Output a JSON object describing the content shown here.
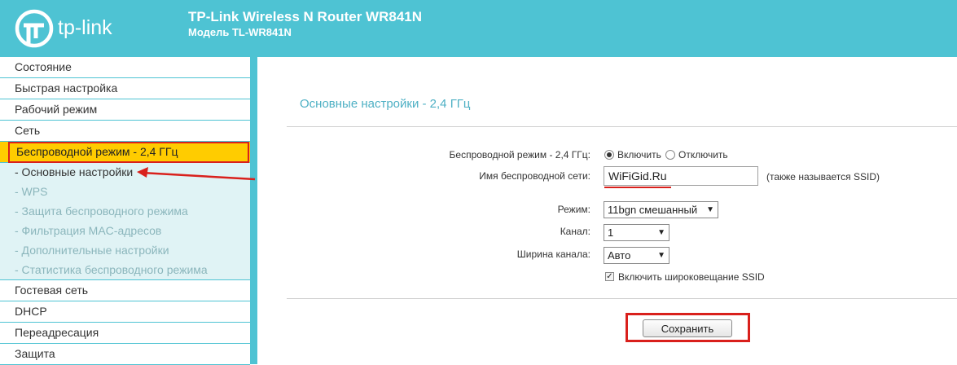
{
  "header": {
    "logo_text": "tp-link",
    "title": "TP-Link Wireless N Router WR841N",
    "model": "Модель TL-WR841N"
  },
  "sidebar": {
    "items_top": [
      {
        "label": "Состояние"
      },
      {
        "label": "Быстрая настройка"
      },
      {
        "label": "Рабочий режим"
      },
      {
        "label": "Сеть"
      }
    ],
    "active": {
      "label": "Беспроводной режим - 2,4 ГГц"
    },
    "sub_items": [
      {
        "label": "- Основные настройки"
      },
      {
        "label": "- WPS"
      },
      {
        "label": "- Защита беспроводного режима"
      },
      {
        "label": "- Фильтрация MAC-адресов"
      },
      {
        "label": "- Дополнительные настройки"
      },
      {
        "label": "- Статистика беспроводного режима"
      }
    ],
    "items_bottom": [
      {
        "label": "Гостевая сеть"
      },
      {
        "label": "DHCP"
      },
      {
        "label": "Переадресация"
      },
      {
        "label": "Защита"
      }
    ]
  },
  "main": {
    "title": "Основные настройки - 2,4 ГГц",
    "wireless_mode_label": "Беспроводной режим - 2,4 ГГц:",
    "enable_label": "Включить",
    "disable_label": "Отключить",
    "wireless_enabled": true,
    "ssid_label": "Имя беспроводной сети:",
    "ssid_value": "WiFiGid.Ru",
    "ssid_hint": "(также называется SSID)",
    "mode_label": "Режим:",
    "mode_value": "11bgn смешанный",
    "channel_label": "Канал:",
    "channel_value": "1",
    "width_label": "Ширина канала:",
    "width_value": "Авто",
    "broadcast_label": "Включить широковещание SSID",
    "broadcast_checked": true,
    "save_label": "Сохранить"
  },
  "colors": {
    "accent": "#4ec3d3",
    "highlight": "#ffcc00",
    "annotation": "#d9201c"
  }
}
